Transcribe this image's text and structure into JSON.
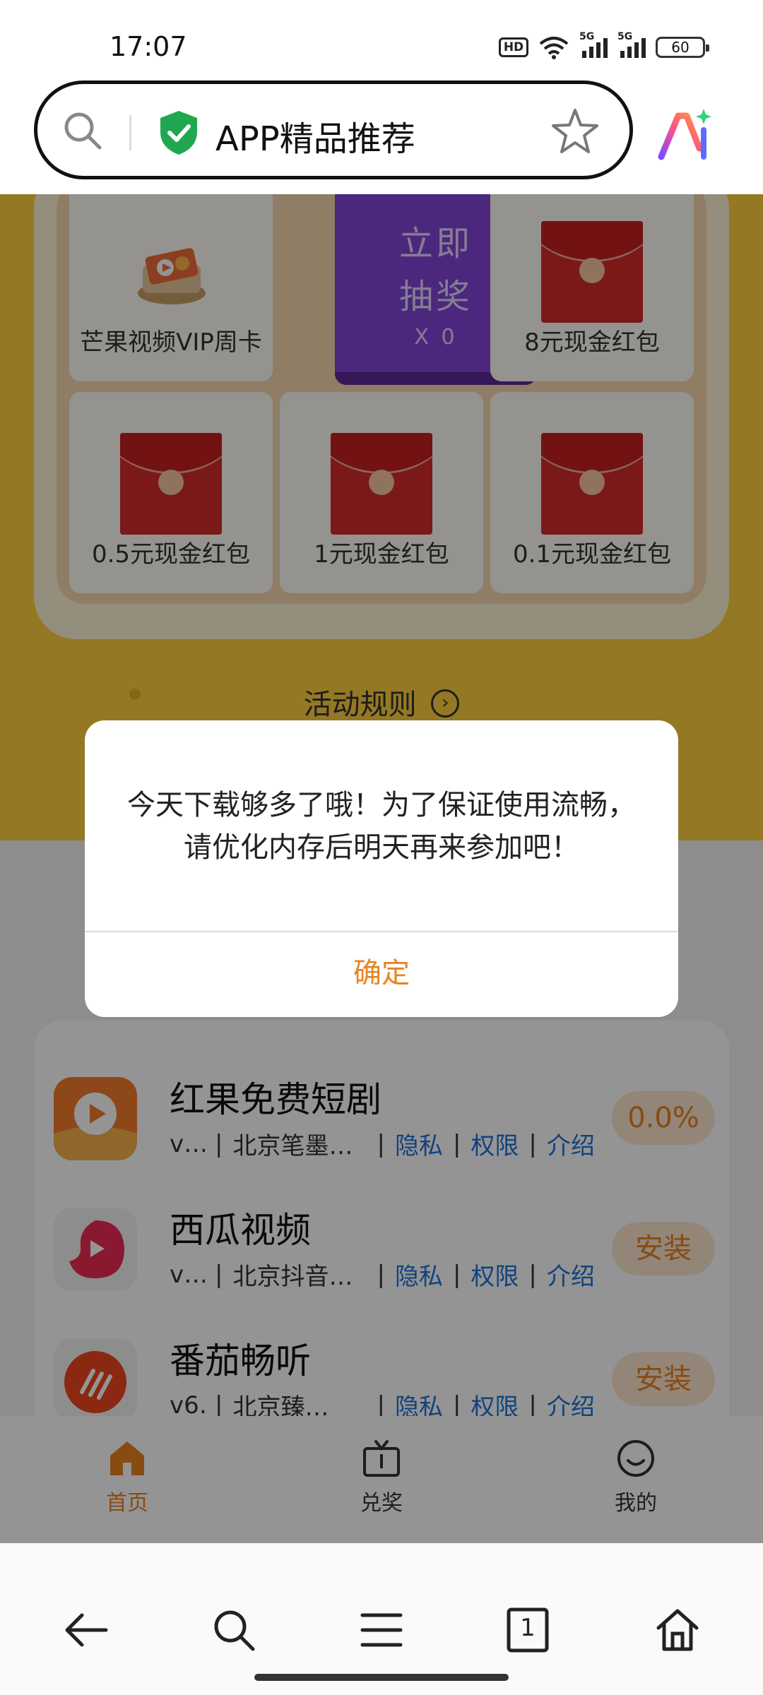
{
  "status_bar": {
    "time": "17:07",
    "hd_label": "HD",
    "network_1": "5G",
    "network_2": "5G",
    "battery": "60"
  },
  "url_bar": {
    "title": "APP精品推荐"
  },
  "lottery": {
    "draw_button": {
      "line1": "立即",
      "line2": "抽奖",
      "count": "X 0"
    },
    "prizes": [
      {
        "label": "芒果视频VIP周卡",
        "icon": "mango-video-icon"
      },
      {
        "label": "8元现金红包",
        "icon": "red-envelope-icon"
      },
      {
        "label": "0.5元现金红包",
        "icon": "red-envelope-icon"
      },
      {
        "label": "1元现金红包",
        "icon": "red-envelope-icon"
      },
      {
        "label": "0.1元现金红包",
        "icon": "red-envelope-icon"
      }
    ],
    "rules_label": "活动规则",
    "rules_arrow": "›"
  },
  "dialog": {
    "message_line1": "今天下载够多了哦！为了保证使用流畅，",
    "message_line2": "请优化内存后明天再来参加吧！",
    "confirm_label": "确定"
  },
  "apps": [
    {
      "name": "红果免费短剧",
      "version": "v…",
      "developer": "北京笔墨…",
      "privacy": "隐私",
      "permissions": "权限",
      "intro": "介绍",
      "action": "0.0%"
    },
    {
      "name": "西瓜视频",
      "version": "v…",
      "developer": "北京抖音…",
      "privacy": "隐私",
      "permissions": "权限",
      "intro": "介绍",
      "action": "安装"
    },
    {
      "name": "番茄畅听",
      "version": "v6…",
      "developer": "北京臻…",
      "privacy": "隐私",
      "permissions": "权限",
      "intro": "介绍",
      "action": "安装"
    }
  ],
  "tabs": [
    {
      "label": "首页",
      "icon": "home-icon",
      "active": true
    },
    {
      "label": "兑奖",
      "icon": "tv-icon",
      "active": false
    },
    {
      "label": "我的",
      "icon": "smile-icon",
      "active": false
    }
  ],
  "browser_nav": {
    "tab_count": "1"
  },
  "colors": {
    "accent_orange": "#e88420",
    "hero_yellow": "#ffcf3d",
    "draw_purple": "#8246d8",
    "link_blue": "#1e73d8",
    "envelope_red": "#d52b2b"
  }
}
